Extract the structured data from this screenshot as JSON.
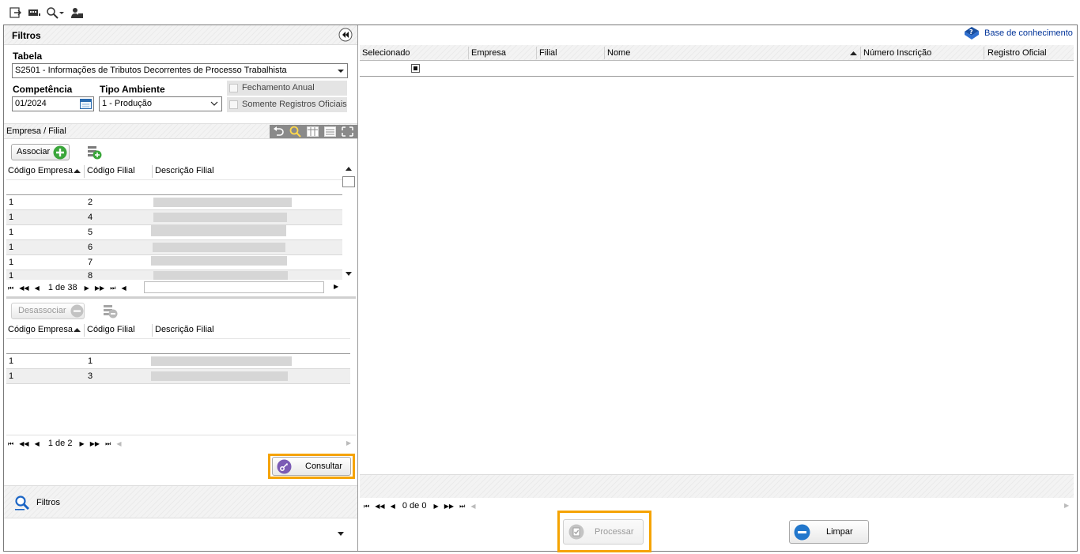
{
  "toolbar": {
    "icons": [
      "exit-icon",
      "keyboard-icon",
      "search-dropdown-icon",
      "user-icon"
    ]
  },
  "filters": {
    "title": "Filtros",
    "tabela_label": "Tabela",
    "tabela_value": "S2501 - Informações de Tributos Decorrentes de Processo Trabalhista",
    "competencia_label": "Competência",
    "competencia_value": "01/2024",
    "tipo_ambiente_label": "Tipo Ambiente",
    "tipo_ambiente_value": "1 - Produção",
    "fechamento_anual": "Fechamento Anual",
    "somente_oficiais": "Somente Registros Oficiais"
  },
  "empresa_filial": {
    "title": "Empresa / Filial",
    "associar": "Associar",
    "desassociar": "Desassociar",
    "col_codigo_empresa": "Código Empresa",
    "col_codigo_filial": "Código Filial",
    "col_descricao_filial": "Descrição Filial",
    "available_rows": [
      {
        "empresa": "1",
        "filial": "2"
      },
      {
        "empresa": "1",
        "filial": "4"
      },
      {
        "empresa": "1",
        "filial": "5"
      },
      {
        "empresa": "1",
        "filial": "6"
      },
      {
        "empresa": "1",
        "filial": "7"
      },
      {
        "empresa": "1",
        "filial": "8"
      }
    ],
    "available_pager": "1 de 38",
    "selected_rows": [
      {
        "empresa": "1",
        "filial": "1"
      },
      {
        "empresa": "1",
        "filial": "3"
      }
    ],
    "selected_pager": "1 de 2"
  },
  "consultar": "Consultar",
  "bottom_nav": {
    "filtros": "Filtros"
  },
  "results": {
    "base_conhecimento": "Base de conhecimento",
    "col_selecionado": "Selecionado",
    "col_empresa": "Empresa",
    "col_filial": "Filial",
    "col_nome": "Nome",
    "col_numero_inscricao": "Número Inscrição",
    "col_registro_oficial": "Registro Oficial",
    "pager": "0 de 0",
    "processar": "Processar",
    "limpar": "Limpar"
  },
  "colors": {
    "highlight": "#f5a300",
    "associar_green": "#3aa63a",
    "consultar_purple": "#7b5bb5",
    "limpar_blue": "#2277cc",
    "link_blue": "#003399"
  }
}
